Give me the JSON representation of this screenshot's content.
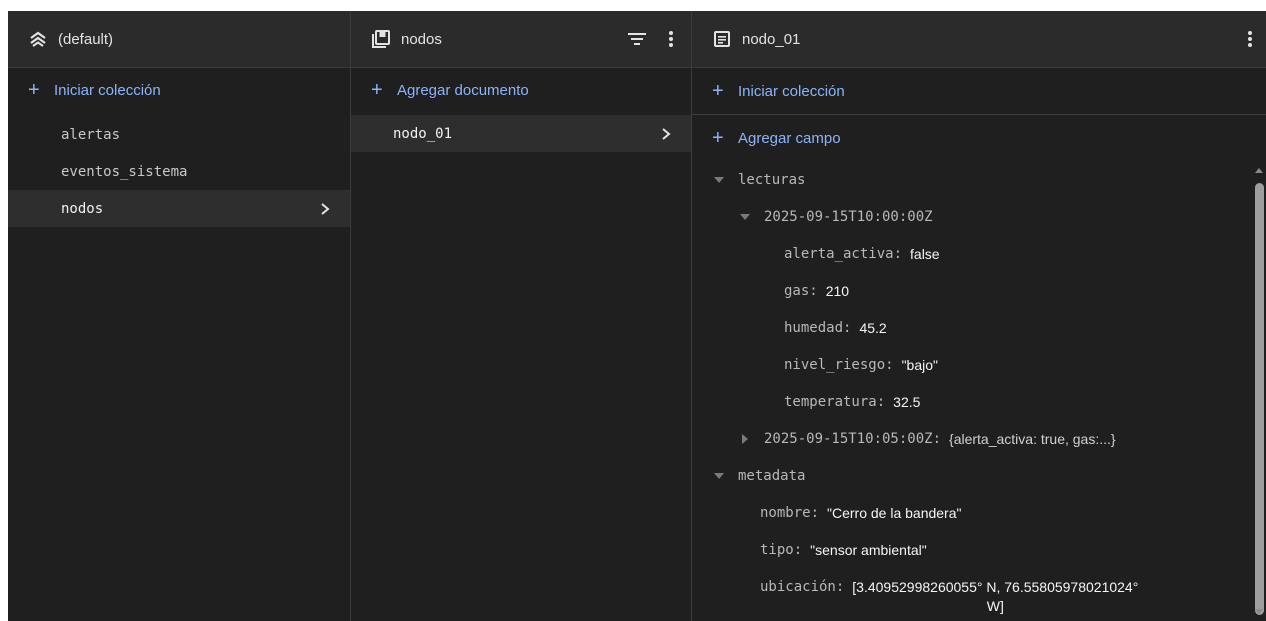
{
  "panel1": {
    "title": "(default)",
    "add_label": "Iniciar colección",
    "collections": [
      {
        "label": "alertas"
      },
      {
        "label": "eventos_sistema"
      },
      {
        "label": "nodos"
      }
    ]
  },
  "panel2": {
    "title": "nodos",
    "add_label": "Agregar documento",
    "documents": [
      {
        "label": "nodo_01"
      }
    ]
  },
  "panel3": {
    "title": "nodo_01",
    "add_collection_label": "Iniciar colección",
    "add_field_label": "Agregar campo",
    "fields": {
      "lecturas_key": "lecturas",
      "ts1_key": "2025-09-15T10:00:00Z",
      "alerta_key": "alerta_activa:",
      "alerta_val": "false",
      "gas_key": "gas:",
      "gas_val": "210",
      "humedad_key": "humedad:",
      "humedad_val": "45.2",
      "nivel_key": "nivel_riesgo:",
      "nivel_val": "\"bajo\"",
      "temp_key": "temperatura:",
      "temp_val": "32.5",
      "ts2_key": "2025-09-15T10:05:00Z:",
      "ts2_val": "{alerta_activa: true, gas:...}",
      "metadata_key": "metadata",
      "nombre_key": "nombre:",
      "nombre_val": "\"Cerro de la bandera\"",
      "tipo_key": "tipo:",
      "tipo_val": "\"sensor ambiental\"",
      "ubic_key": "ubicación:",
      "ubic_val_1": "[3.40952998260055° N, 76.55805978021024°",
      "ubic_val_2": "W]"
    }
  },
  "colors": {
    "background": "#1f1f1f",
    "header": "#2b2b2b",
    "accent": "#8ab4f8",
    "selected": "#2e2e2e"
  }
}
